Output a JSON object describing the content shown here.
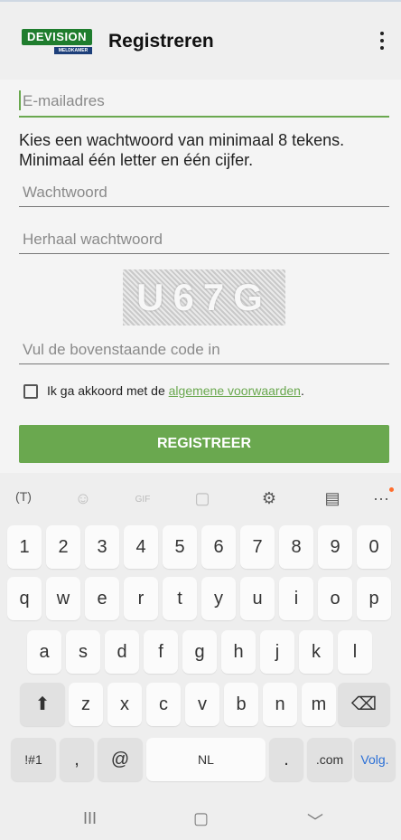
{
  "app": {
    "logo_text": "DEVISION",
    "logo_sub": "MELDKAMER",
    "title": "Registreren",
    "menu_icon": "more-vertical-icon"
  },
  "form": {
    "email_placeholder": "E-mailadres",
    "password_hint": "Kies een wachtwoord van minimaal 8 tekens. Minimaal één letter en één cijfer.",
    "password_placeholder": "Wachtwoord",
    "repeat_password_placeholder": "Herhaal wachtwoord",
    "captcha_text": "U67G",
    "captcha_placeholder": "Vul de bovenstaande code in",
    "agree_prefix": "Ik ga akkoord met de ",
    "agree_link": "algemene voorwaarden",
    "agree_suffix": ".",
    "submit_label": "REGISTREER"
  },
  "keyboard": {
    "toolbar": {
      "translate_icon": "(T)",
      "emoji_icon": "☺",
      "gif_label": "GIF",
      "sticker_icon": "sticker-icon",
      "settings_icon": "gear-icon",
      "clipboard_icon": "clipboard-icon",
      "more_label": "···"
    },
    "row_numbers": [
      "1",
      "2",
      "3",
      "4",
      "5",
      "6",
      "7",
      "8",
      "9",
      "0"
    ],
    "row_1": [
      "q",
      "w",
      "e",
      "r",
      "t",
      "y",
      "u",
      "i",
      "o",
      "p"
    ],
    "row_2": [
      "a",
      "s",
      "d",
      "f",
      "g",
      "h",
      "j",
      "k",
      "l"
    ],
    "row_3": [
      "z",
      "x",
      "c",
      "v",
      "b",
      "n",
      "m"
    ],
    "shift_label": "⬆",
    "backspace_label": "⌫",
    "symbols_label": "!#1",
    "comma_label": ",",
    "at_label": "@",
    "space_label": "NL",
    "period_label": ".",
    "dotcom_label": ".com",
    "next_label": "Volg."
  },
  "nav": {
    "recents_icon": "III",
    "home_icon": "▢",
    "back_icon": "﹀"
  },
  "colors": {
    "accent": "#6aa84f",
    "logo_green": "#1f7d2e",
    "logo_blue": "#1d3f7a"
  }
}
